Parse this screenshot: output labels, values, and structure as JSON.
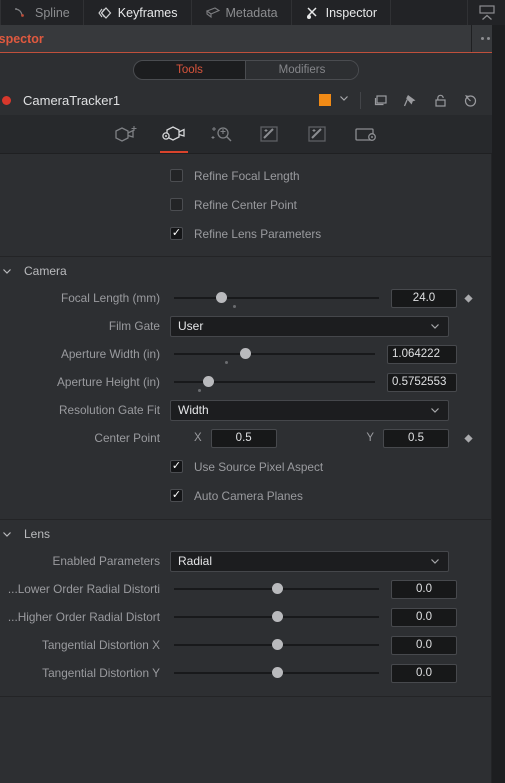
{
  "tabs": [
    {
      "label": "Spline",
      "icon": "spline-icon",
      "active": false
    },
    {
      "label": "Keyframes",
      "icon": "keyframes-icon",
      "active": true
    },
    {
      "label": "Metadata",
      "icon": "metadata-icon",
      "active": false
    },
    {
      "label": "Inspector",
      "icon": "inspector-icon",
      "active": true
    }
  ],
  "panel": {
    "title": "nspector",
    "more_icon": "more-options-icon"
  },
  "segmented": {
    "tools_label": "Tools",
    "modifiers_label": "Modifiers",
    "selected": "Tools"
  },
  "node": {
    "name": "CameraTracker1",
    "status_color": "#d8382c",
    "swatch_color": "#f08a16",
    "icons": [
      "color-swatch",
      "chevron-down-icon",
      "duplicate-icon",
      "pin-icon",
      "lock-icon",
      "reset-icon"
    ]
  },
  "modebar": {
    "buttons": [
      {
        "name": "track-camera-icon",
        "selected": false
      },
      {
        "name": "camera-settings-icon",
        "selected": true
      },
      {
        "name": "refine-solve-icon",
        "selected": false
      },
      {
        "name": "export-scene-icon",
        "selected": false
      },
      {
        "name": "cleanup-tracks-icon",
        "selected": false
      },
      {
        "name": "options-icon",
        "selected": false
      }
    ]
  },
  "refine": {
    "checkboxes": [
      {
        "label": "Refine Focal Length",
        "checked": false
      },
      {
        "label": "Refine Center Point",
        "checked": false
      },
      {
        "label": "Refine Lens Parameters",
        "checked": true
      }
    ]
  },
  "camera": {
    "title": "Camera",
    "focal_length": {
      "label": "Focal Length (mm)",
      "value": "24.0",
      "knob_pct": 24,
      "default_pct": 30
    },
    "film_gate": {
      "label": "Film Gate",
      "value": "User"
    },
    "aperture_width": {
      "label": "Aperture Width (in)",
      "value": "1.064222",
      "knob_pct": 36,
      "default_pct": 27
    },
    "aperture_height": {
      "label": "Aperture Height (in)",
      "value": "0.5752553",
      "knob_pct": 18,
      "default_pct": 14
    },
    "resolution_gate_fit": {
      "label": "Resolution Gate Fit",
      "value": "Width"
    },
    "center_point": {
      "label": "Center Point",
      "x_axis": "X",
      "x_value": "0.5",
      "y_axis": "Y",
      "y_value": "0.5"
    },
    "use_source_pixel_aspect": {
      "label": "Use Source Pixel Aspect",
      "checked": true
    },
    "auto_camera_planes": {
      "label": "Auto Camera Planes",
      "checked": true
    }
  },
  "lens": {
    "title": "Lens",
    "enabled_parameters": {
      "label": "Enabled Parameters",
      "value": "Radial"
    },
    "sliders": [
      {
        "label": "Lower Order Radial Distorti...",
        "value": "0.0",
        "knob_pct": 50
      },
      {
        "label": "Higher Order Radial Distort...",
        "value": "0.0",
        "knob_pct": 50
      },
      {
        "label": "Tangential Distortion X",
        "value": "0.0",
        "knob_pct": 50
      },
      {
        "label": "Tangential Distortion Y",
        "value": "0.0",
        "knob_pct": 50
      }
    ]
  },
  "colors": {
    "accent_red": "#d9432c",
    "panel_bg": "#2d2f32",
    "header_bg": "#37393c",
    "text_muted": "#9a9b9f"
  }
}
